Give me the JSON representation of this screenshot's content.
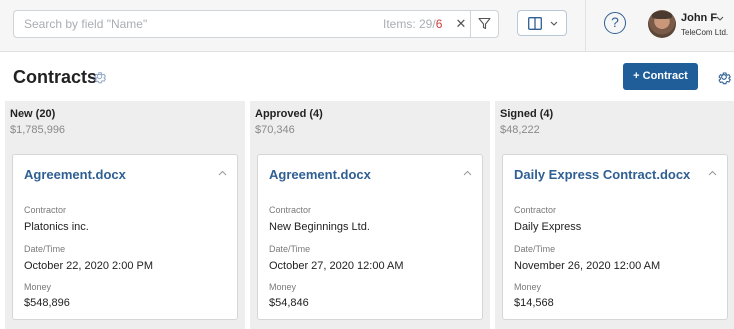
{
  "search": {
    "placeholder": "Search by field \"Name\"",
    "items_label": "Items: 29",
    "items_separator": "/",
    "items_filtered": "6"
  },
  "user": {
    "name": "John F",
    "company": "TeleCom Ltd."
  },
  "page": {
    "title": "Contracts",
    "add_button": "+ Contract"
  },
  "columns": [
    {
      "title": "New (20)",
      "sum": "$1,785,996",
      "card": {
        "title": "Agreement.docx",
        "contractor_label": "Contractor",
        "contractor": "Platonics inc.",
        "datetime_label": "Date/Time",
        "datetime": "October 22, 2020 2:00 PM",
        "money_label": "Money",
        "money": "$548,896"
      }
    },
    {
      "title": "Approved (4)",
      "sum": "$70,346",
      "card": {
        "title": "Agreement.docx",
        "contractor_label": "Contractor",
        "contractor": "New Beginnings Ltd.",
        "datetime_label": "Date/Time",
        "datetime": "October 27, 2020 12:00 AM",
        "money_label": "Money",
        "money": "$54,846"
      }
    },
    {
      "title": "Signed (4)",
      "sum": "$48,222",
      "card": {
        "title": "Daily Express Contract.docx",
        "contractor_label": "Contractor",
        "contractor": "Daily Express",
        "datetime_label": "Date/Time",
        "datetime": "November 26, 2020 12:00 AM",
        "money_label": "Money",
        "money": "$14,568"
      }
    }
  ],
  "colors": {
    "accent": "#1f5e99",
    "link": "#2f5f93",
    "filtered_count": "#d23b3b",
    "column_bg": "#eeeeee"
  },
  "icons": {
    "clear": "close-icon",
    "filter": "filter-icon",
    "view": "columns-view-icon",
    "help": "help-icon",
    "settings": "gear-icon"
  }
}
